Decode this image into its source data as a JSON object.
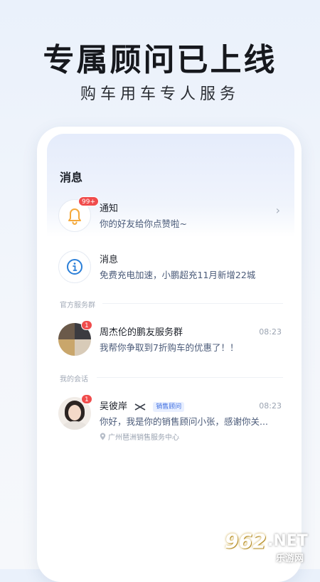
{
  "hero": {
    "title": "专属顾问已上线",
    "subtitle": "购车用车专人服务"
  },
  "screen": {
    "title": "消息",
    "notification": {
      "name": "通知",
      "preview": "你的好友给你点赞啦~",
      "badge": "99+",
      "icon": "bell-icon"
    },
    "message": {
      "name": "消息",
      "preview": "免费充电加速，小鹏超充11月新增22城",
      "icon": "info-icon"
    },
    "official_section_label": "官方服务群",
    "group": {
      "name": "周杰伦的鹏友服务群",
      "preview": "我帮你争取到7折购车的优惠了！！",
      "time": "08:23",
      "badge": "1"
    },
    "conversation_section_label": "我的会话",
    "conversation": {
      "name": "吴彼岸",
      "tag": "销售顾问",
      "preview": "你好，我是你的销售顾问小张，感谢你关...",
      "time": "08:23",
      "badge": "1",
      "location": "广州琶洲销售服务中心"
    }
  },
  "watermark": {
    "number": "962",
    "suffix": ".NET",
    "site": "乐游网"
  },
  "colors": {
    "accent": "#3f6fe0",
    "badge": "#f04c4c",
    "bell": "#f5a93b",
    "info": "#2b7fd8"
  }
}
